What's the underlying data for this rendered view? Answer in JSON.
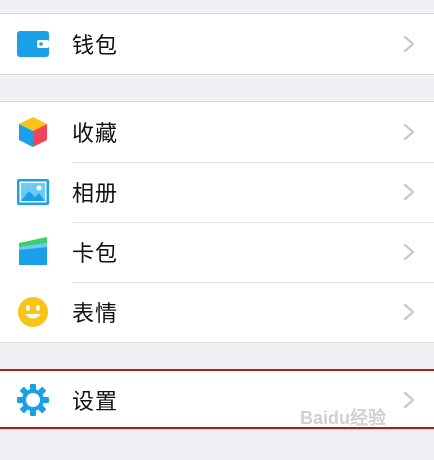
{
  "groups": [
    {
      "items": [
        {
          "label": "钱包",
          "icon": "wallet-icon"
        }
      ]
    },
    {
      "items": [
        {
          "label": "收藏",
          "icon": "favorites-cube-icon"
        },
        {
          "label": "相册",
          "icon": "album-photo-icon"
        },
        {
          "label": "卡包",
          "icon": "card-package-icon"
        },
        {
          "label": "表情",
          "icon": "smiley-face-icon"
        }
      ]
    },
    {
      "items": [
        {
          "label": "设置",
          "icon": "gear-icon"
        }
      ]
    }
  ],
  "watermark": "Baidu经验",
  "colors": {
    "background": "#efeff4",
    "blue": "#1aa0e8",
    "highlight": "#b01c1c",
    "smiley": "#f8c418"
  }
}
